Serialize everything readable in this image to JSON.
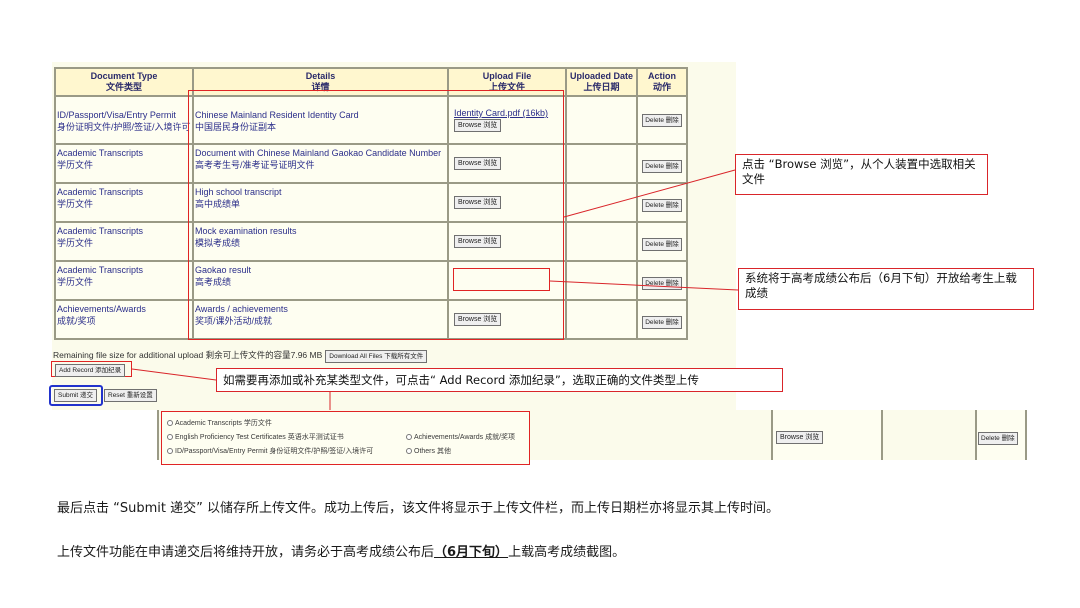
{
  "table": {
    "headers": [
      {
        "en": "Document Type",
        "zh": "文件类型"
      },
      {
        "en": "Details",
        "zh": "详情"
      },
      {
        "en": "Upload File",
        "zh": "上传文件"
      },
      {
        "en": "Uploaded Date",
        "zh": "上传日期"
      },
      {
        "en": "Action",
        "zh": "动作"
      }
    ],
    "rows": [
      {
        "type_en": "ID/Passport/Visa/Entry Permit",
        "type_zh": "身份证明文件/护照/签证/入境许可",
        "detail_en": "Chinese Mainland Resident Identity Card",
        "detail_zh": "中国居民身份证副本",
        "file": "Identity Card.pdf (16kb)",
        "browse": "Browse 浏览",
        "delete": "Delete 删除"
      },
      {
        "type_en": "Academic Transcripts",
        "type_zh": "学历文件",
        "detail_en": "Document with Chinese Mainland Gaokao Candidate Number",
        "detail_zh": "高考考生号/准考证号证明文件",
        "browse": "Browse 浏览",
        "delete": "Delete 删除"
      },
      {
        "type_en": "Academic Transcripts",
        "type_zh": "学历文件",
        "detail_en": "High school transcript",
        "detail_zh": "高中成绩单",
        "browse": "Browse 浏览",
        "delete": "Delete 删除"
      },
      {
        "type_en": "Academic Transcripts",
        "type_zh": "学历文件",
        "detail_en": "Mock examination results",
        "detail_zh": "模拟考成绩",
        "browse": "Browse 浏览",
        "delete": "Delete 删除"
      },
      {
        "type_en": "Academic Transcripts",
        "type_zh": "学历文件",
        "detail_en": "Gaokao result",
        "detail_zh": "高考成绩",
        "browse": "",
        "delete": "Delete 删除"
      },
      {
        "type_en": "Achievements/Awards",
        "type_zh": "成就/奖项",
        "detail_en": "Awards / achievements",
        "detail_zh": "奖项/课外活动/成就",
        "browse": "Browse 浏览",
        "delete": "Delete 删除"
      }
    ]
  },
  "remaining_text": "Remaining file size for additional upload 剩余可上传文件的容量7.96 MB",
  "download_all": "Download All Files 下载所有文件",
  "add_record": "Add Record 添加纪录",
  "submit": "Submit 递交",
  "reset": "Reset 重新设置",
  "callouts": {
    "browse": "点击 “Browse 浏览”，从个人装置中选取相关文件",
    "gaokao": "系统将于高考成绩公布后（6月下旬）开放给考生上载成绩",
    "add_record": "如需要再添加或补充某类型文件，可点击“ Add Record 添加纪录”，选取正确的文件类型上传"
  },
  "record_types": {
    "academic": "Academic Transcripts 学历文件",
    "english": "English Proficiency Test Certificates 英语水平测试证书",
    "achievements": "Achievements/Awards 成就/奖项",
    "id": "ID/Passport/Visa/Entry Permit 身份证明文件/护照/签证/入境许可",
    "others": "Others 其他"
  },
  "lower_browse": "Browse 浏览",
  "lower_delete": "Delete 删除",
  "para1": "最后点击 “Submit 递交” 以储存所上传文件。成功上传后，该文件将显示于上传文件栏，而上传日期栏亦将显示其上传时间。",
  "para2_a": "上传文件功能在申请递交后将维持开放，请务必于高考成绩公布后",
  "para2_b": "（6月下旬）",
  "para2_c": "上载高考成绩截图。"
}
